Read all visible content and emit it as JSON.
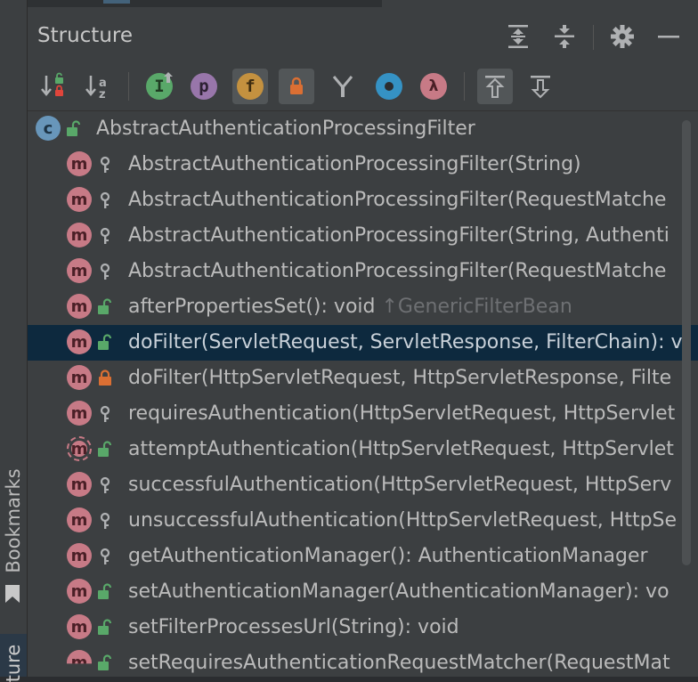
{
  "sidebar": {
    "bookmarks_label": "Bookmarks",
    "structure_label": "ture"
  },
  "panel": {
    "title": "Structure",
    "header_icons": [
      "expand-all-icon",
      "collapse-all-icon",
      "gear-icon",
      "minimize-icon"
    ],
    "toolbar_icons": [
      "sort-by-visibility-icon",
      "sort-alphabetically-icon",
      "show-inherited-icon",
      "show-properties-icon",
      "show-fields-icon",
      "show-non-public-icon",
      "show-anonymous-icon",
      "show-lambdas-icon",
      "show-lambdas-2-icon",
      "autoscroll-to-source-icon",
      "autoscroll-from-source-icon"
    ],
    "toolbar_letters": {
      "inherited": "I",
      "properties": "p",
      "fields": "f",
      "lambdas": "λ",
      "sort_az": "az"
    }
  },
  "tree": {
    "class_node": {
      "icon_letter": "c",
      "name": "AbstractAuthenticationProcessingFilter",
      "access": "public"
    },
    "members": [
      {
        "name": "AbstractAuthenticationProcessingFilter(String)",
        "access": "protected",
        "inherited": ""
      },
      {
        "name": "AbstractAuthenticationProcessingFilter(RequestMatche",
        "access": "protected",
        "inherited": ""
      },
      {
        "name": "AbstractAuthenticationProcessingFilter(String, Authenti",
        "access": "protected",
        "inherited": ""
      },
      {
        "name": "AbstractAuthenticationProcessingFilter(RequestMatche",
        "access": "protected",
        "inherited": ""
      },
      {
        "name": "afterPropertiesSet(): void ",
        "access": "public",
        "inherited": "↑GenericFilterBean"
      },
      {
        "name": "doFilter(ServletRequest, ServletResponse, FilterChain): v",
        "access": "public",
        "inherited": "",
        "selected": true
      },
      {
        "name": "doFilter(HttpServletRequest, HttpServletResponse, Filte",
        "access": "private",
        "inherited": ""
      },
      {
        "name": "requiresAuthentication(HttpServletRequest, HttpServlet",
        "access": "protected",
        "inherited": ""
      },
      {
        "name": "attemptAuthentication(HttpServletRequest, HttpServlet",
        "access": "public",
        "inherited": "",
        "abstract": true
      },
      {
        "name": "successfulAuthentication(HttpServletRequest, HttpServ",
        "access": "protected",
        "inherited": ""
      },
      {
        "name": "unsuccessfulAuthentication(HttpServletRequest, HttpSe",
        "access": "protected",
        "inherited": ""
      },
      {
        "name": "getAuthenticationManager(): AuthenticationManager",
        "access": "protected",
        "inherited": ""
      },
      {
        "name": "setAuthenticationManager(AuthenticationManager): vo",
        "access": "public",
        "inherited": ""
      },
      {
        "name": "setFilterProcessesUrl(String): void",
        "access": "public",
        "inherited": ""
      },
      {
        "name": "setRequiresAuthenticationRequestMatcher(RequestMat",
        "access": "public",
        "inherited": "",
        "partial": true
      }
    ],
    "method_icon_letter": "m"
  },
  "colors": {
    "method_icon": "#c77a86",
    "class_icon": "#6896ba",
    "public_lock": "#59a869",
    "private_lock": "#db6f33",
    "selection": "#0d293e"
  }
}
